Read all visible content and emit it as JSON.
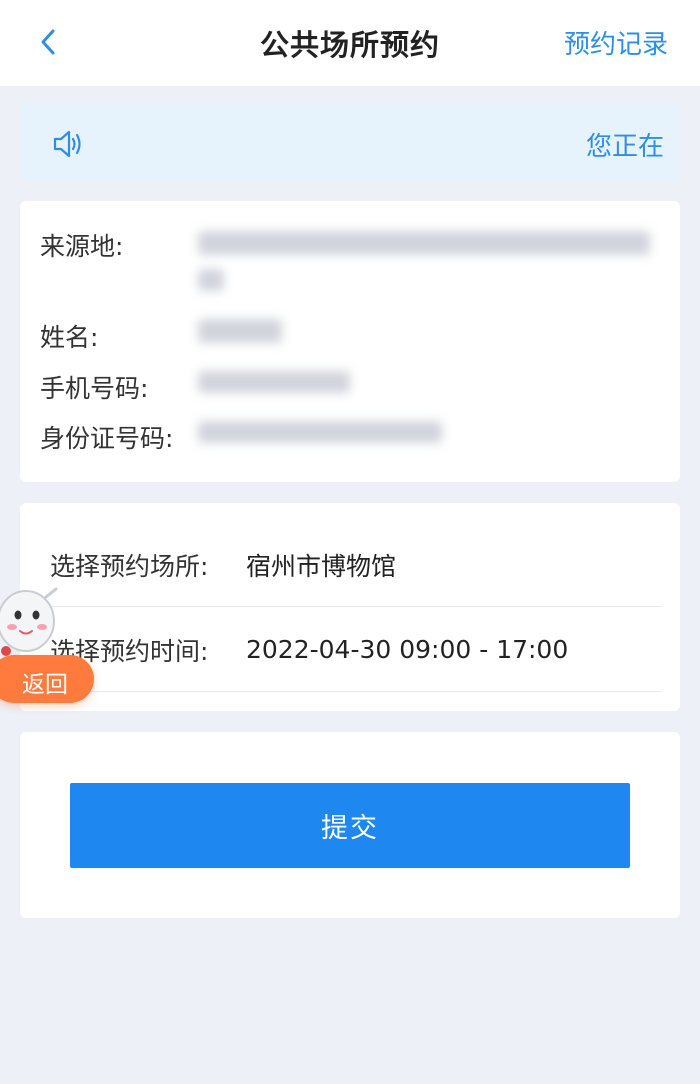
{
  "header": {
    "title": "公共场所预约",
    "records_label": "预约记录"
  },
  "notice": {
    "text": "您正在"
  },
  "info": {
    "origin_label": "来源地:",
    "name_label": "姓名:",
    "phone_label": "手机号码:",
    "id_label": "身份证号码:"
  },
  "selection": {
    "place_label": "选择预约场所:",
    "place_value": "宿州市博物馆",
    "time_label": "选择预约时间:",
    "time_value": "2022-04-30 09:00 - 17:00"
  },
  "submit": {
    "label": "提交"
  },
  "floating": {
    "back_label": "返回"
  },
  "colors": {
    "accent": "#1e88f0",
    "link": "#2e8ee6",
    "float_button": "#ff7a3d",
    "background": "#edf0f7"
  },
  "icons": {
    "back": "chevron-left-icon",
    "notice": "speaker-icon",
    "mascot": "mascot-icon"
  }
}
